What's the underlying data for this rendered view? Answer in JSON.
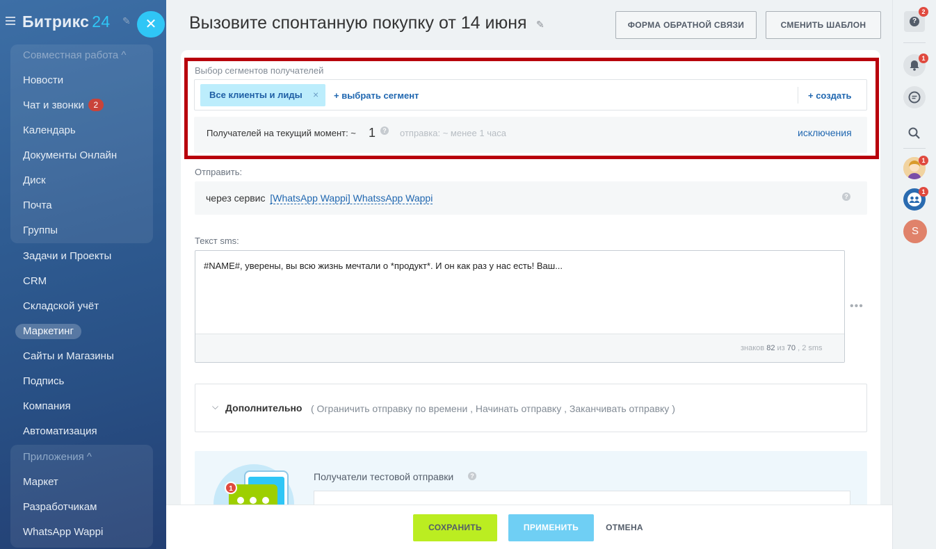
{
  "sidebar": {
    "logo_text": "Битрикс",
    "logo_num": "24",
    "groups": [
      {
        "head": "Совместная работа ^"
      },
      {
        "head": "Приложения ^"
      }
    ],
    "items": [
      {
        "label": "Новости"
      },
      {
        "label": "Чат и звонки",
        "badge": "2"
      },
      {
        "label": "Календарь"
      },
      {
        "label": "Документы Онлайн"
      },
      {
        "label": "Диск"
      },
      {
        "label": "Почта"
      },
      {
        "label": "Группы"
      },
      {
        "label": "Задачи и Проекты"
      },
      {
        "label": "CRM"
      },
      {
        "label": "Складской учёт"
      },
      {
        "label": "Маркетинг"
      },
      {
        "label": "Сайты и Магазины"
      },
      {
        "label": "Подпись"
      },
      {
        "label": "Компания"
      },
      {
        "label": "Автоматизация"
      },
      {
        "label": "Маркет"
      },
      {
        "label": "Разработчикам"
      },
      {
        "label": "WhatsApp Wappi"
      }
    ]
  },
  "header": {
    "title": "Вызовите спонтанную покупку от 14 июня",
    "feedback_btn": "ФОРМА ОБРАТНОЙ СВЯЗИ",
    "template_btn": "СМЕНИТЬ ШАБЛОН"
  },
  "segments": {
    "label": "Выбор сегментов получателей",
    "tag": "Все клиенты и лиды",
    "choose": "+ выбрать сегмент",
    "create": "+ создать",
    "recipients_text": "Получателей на текущий момент: ~",
    "recipients_count": "1",
    "send_time": "отправка: ~ менее 1 часа",
    "exclusions": "исключения"
  },
  "send": {
    "label": "Отправить:",
    "via": "через сервис",
    "service": "[WhatsApp Wappi] WhatssApp Wappi"
  },
  "sms": {
    "label": "Текст sms:",
    "text": "#NAME#, уверены, вы всю жизнь мечтали о *продукт*. И он как раз у нас есть! Ваш...",
    "count_prefix": "знаков",
    "count_chars": "82",
    "count_of": "из",
    "count_limit": "70",
    "count_sms": ", 2 sms"
  },
  "advanced": {
    "title": "Дополнительно",
    "options": "( Ограничить отправку по времени ,  Начинать отправку ,  Заканчивать отправку  )"
  },
  "test": {
    "label": "Получатели тестовой отправки",
    "badge": "1"
  },
  "footer": {
    "save": "СОХРАНИТЬ",
    "apply": "ПРИМЕНИТЬ",
    "cancel": "ОТМЕНА"
  },
  "right_panel": {
    "help_badge": "2",
    "notif_badge": "1",
    "avatar1_badge": "1",
    "avatar2_badge": "1",
    "user_letter": "S"
  },
  "colors": {
    "highlight_frame": "#b8000c",
    "accent": "#2fc6f6",
    "save": "#bbed21",
    "link": "#2067b0"
  }
}
